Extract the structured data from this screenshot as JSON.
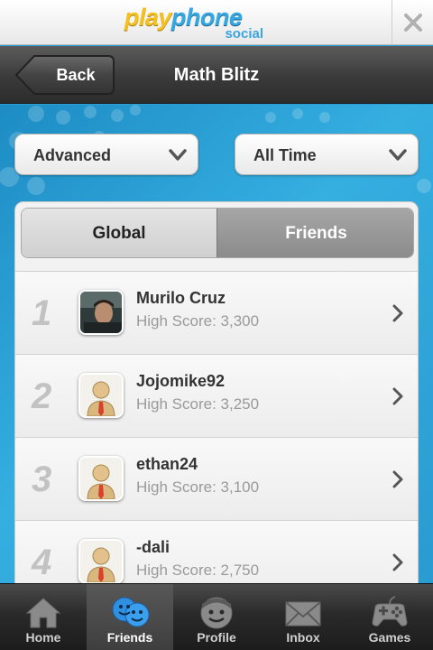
{
  "brand": {
    "logo_play": "play",
    "logo_phone": "phone",
    "logo_social": "social"
  },
  "header": {
    "back_label": "Back",
    "title": "Math Blitz"
  },
  "filters": {
    "mode": "Advanced",
    "period": "All Time"
  },
  "segment": {
    "global_label": "Global",
    "friends_label": "Friends",
    "selected": "Global"
  },
  "leaderboard": [
    {
      "rank": "1",
      "name": "Murilo Cruz",
      "score": "High Score: 3,300",
      "avatar": "photo"
    },
    {
      "rank": "2",
      "name": "Jojomike92",
      "score": "High Score: 3,250",
      "avatar": "default-person-icon"
    },
    {
      "rank": "3",
      "name": "ethan24",
      "score": "High Score: 3,100",
      "avatar": "default-person-icon"
    },
    {
      "rank": "4",
      "name": "-dali",
      "score": "High Score: 2,750",
      "avatar": "default-person-icon"
    }
  ],
  "tabs": [
    {
      "label": "Home",
      "icon": "home-icon"
    },
    {
      "label": "Friends",
      "icon": "friends-icon",
      "active": true
    },
    {
      "label": "Profile",
      "icon": "profile-icon"
    },
    {
      "label": "Inbox",
      "icon": "inbox-icon"
    },
    {
      "label": "Games",
      "icon": "gamepad-icon"
    }
  ],
  "colors": {
    "accent_blue": "#2aa0d4",
    "logo_yellow": "#f6c11d",
    "logo_blue": "#35a7e2",
    "bar_dark": "#2c2c2c"
  }
}
